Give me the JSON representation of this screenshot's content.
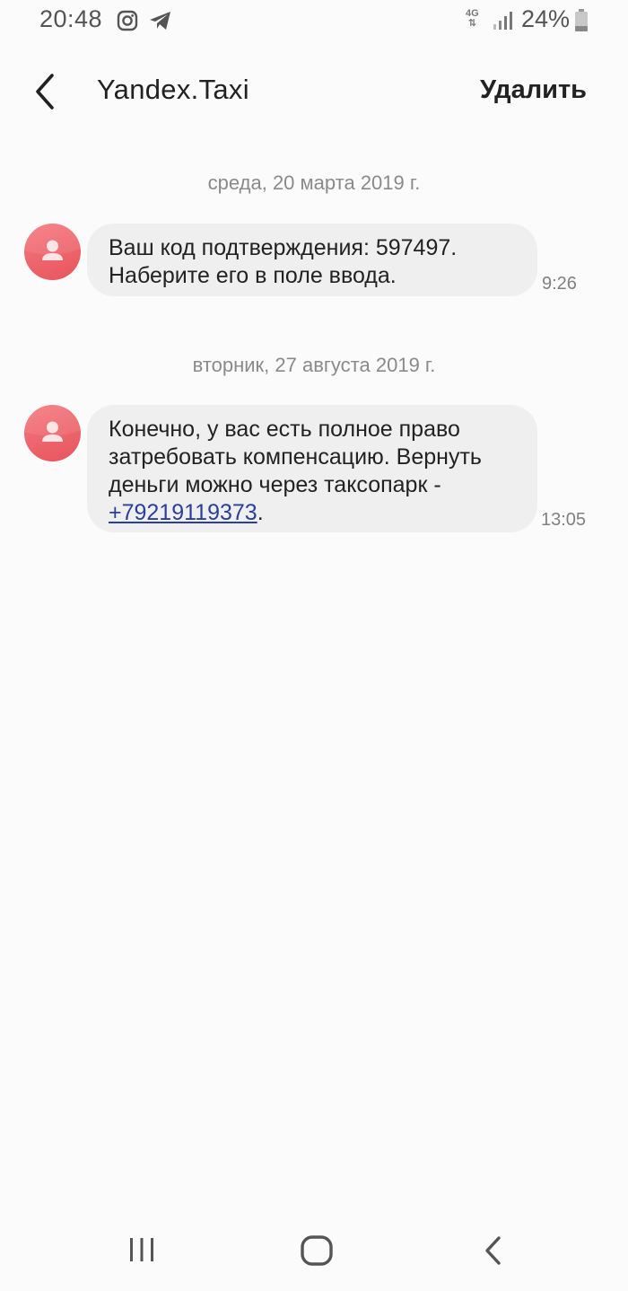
{
  "status_bar": {
    "time": "20:48",
    "icons": [
      "instagram-icon",
      "telegram-icon"
    ],
    "network": "4G",
    "battery_percent": "24%"
  },
  "header": {
    "title": "Yandex.Taxi",
    "delete_label": "Удалить",
    "back_icon": "chevron-left-icon"
  },
  "messages": [
    {
      "date": "среда, 20 марта 2019 г.",
      "text_line1": "Ваш код подтверждения: 597497.",
      "text_line2": "Наберите его в поле ввода.",
      "time": "9:26"
    },
    {
      "date": "вторник, 27 августа 2019 г.",
      "text_line1": "Конечно, у вас есть полное право",
      "text_line2": "затребовать компенсацию. Вернуть",
      "text_line3": "деньги можно через таксопарк -",
      "link": "+79219119373",
      "link_suffix": ".",
      "time": "13:05"
    }
  ],
  "colors": {
    "avatar": "#e8545c",
    "bubble": "#efefef",
    "link": "#2a3f9c",
    "background": "#fbfbfb"
  },
  "nav_bar": {
    "icons": [
      "recent-apps-icon",
      "home-icon",
      "back-icon"
    ]
  }
}
